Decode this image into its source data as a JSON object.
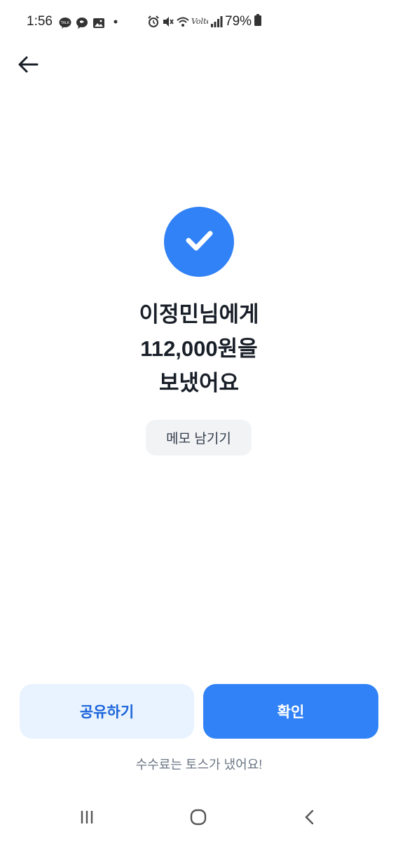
{
  "status_bar": {
    "time": "1:56",
    "battery_percent": "79%",
    "left_icons": [
      "kakaotalk-icon",
      "chat-bubble-icon",
      "gallery-icon",
      "dot-icon"
    ],
    "right_icons": [
      "alarm-icon",
      "mute-icon",
      "wifi-icon",
      "volte-icon",
      "signal-icon",
      "battery-icon"
    ]
  },
  "header": {
    "back_icon": "back-arrow-icon"
  },
  "result": {
    "icon": "check-icon",
    "accent_color": "#3182f6",
    "line1": "이정민님에게",
    "line2": "112,000원을",
    "line3": "보냈어요"
  },
  "memo_button_label": "메모 남기기",
  "actions": {
    "share_label": "공유하기",
    "confirm_label": "확인"
  },
  "fee_note": "수수료는 토스가 냈어요!",
  "nav_bar": {
    "items": [
      "recent-apps-icon",
      "home-icon",
      "back-icon"
    ]
  }
}
